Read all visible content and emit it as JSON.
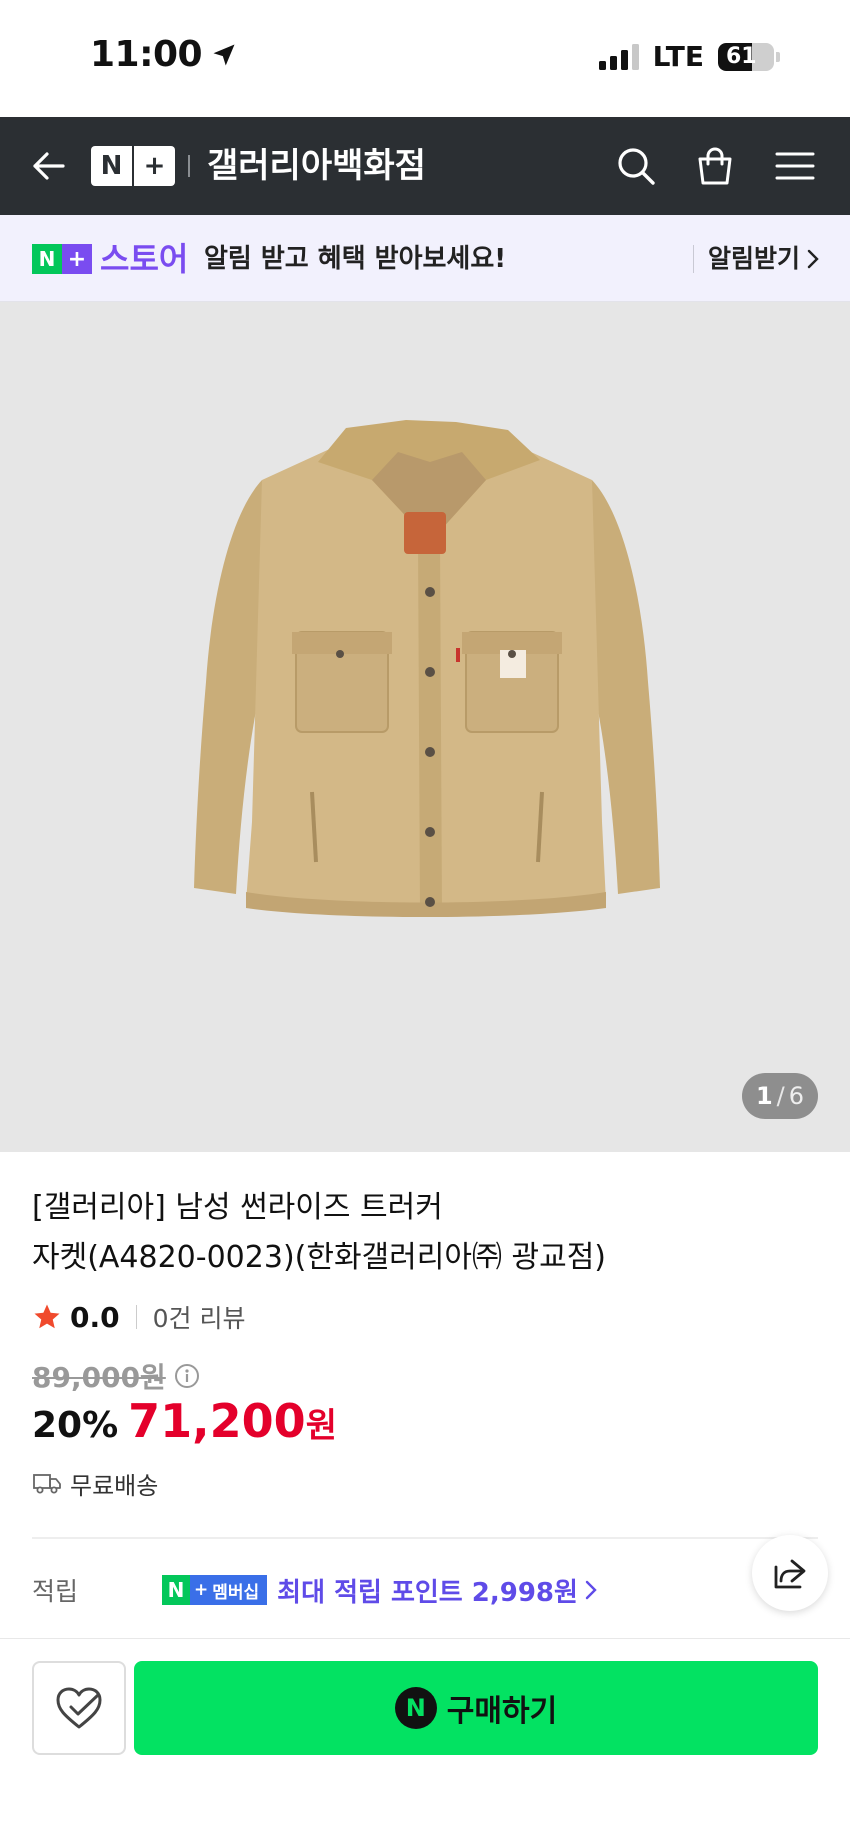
{
  "status_bar": {
    "time": "11:00",
    "network": "LTE",
    "battery": "61",
    "battery_level": 0.61,
    "signal_bars": 3
  },
  "header": {
    "logo_n": "N",
    "logo_plus": "+",
    "store_name": "갤러리아백화점"
  },
  "promo": {
    "logo_n": "N",
    "logo_plus": "+",
    "logo_text": "스토어",
    "message": "알림 받고 혜택 받아보세요!",
    "action": "알림받기"
  },
  "gallery": {
    "current": "1",
    "separator": "/",
    "total": "6"
  },
  "product": {
    "title_line1": "[갤러리아] 남성 썬라이즈 트러커",
    "title_line2": "자켓(A4820-0023)(한화갤러리아㈜ 광교점)",
    "rating": "0.0",
    "review_count": "0건 리뷰",
    "original_price": "89,000원",
    "discount": "20%",
    "price": "71,200",
    "price_unit": "원",
    "shipping": "무료배송"
  },
  "points": {
    "label": "적립",
    "badge_n": "N",
    "badge_plus": "+",
    "badge_text": "멤버십",
    "text": "최대 적립 포인트 2,998원"
  },
  "actions": {
    "buy_icon": "N",
    "buy_label": "구매하기"
  },
  "colors": {
    "header_bg": "#2b2f33",
    "naver_green": "#03c75a",
    "buy_green": "#03e262",
    "purple": "#7a4cf0",
    "sale_red": "#e4002b",
    "rating_star": "#f04a2d"
  }
}
